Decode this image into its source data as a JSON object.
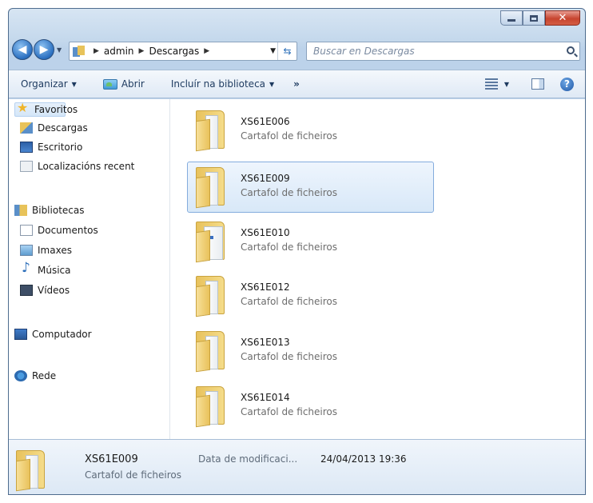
{
  "address": {
    "crumbs": [
      "admin",
      "Descargas"
    ],
    "search_placeholder": "Buscar en Descargas"
  },
  "toolbar": {
    "organize": "Organizar",
    "open": "Abrir",
    "include": "Incluír na biblioteca",
    "more": "»"
  },
  "nav": {
    "favorites": "Favoritos",
    "downloads": "Descargas",
    "desktop": "Escritorio",
    "recent": "Localizacións recent",
    "libraries": "Bibliotecas",
    "documents": "Documentos",
    "images": "Imaxes",
    "music": "Música",
    "videos": "Vídeos",
    "computer": "Computador",
    "network": "Rede"
  },
  "files": [
    {
      "name": "XS61E006",
      "type": "Cartafol de ficheiros"
    },
    {
      "name": "XS61E009",
      "type": "Cartafol de ficheiros"
    },
    {
      "name": "XS61E010",
      "type": "Cartafol de ficheiros"
    },
    {
      "name": "XS61E012",
      "type": "Cartafol de ficheiros"
    },
    {
      "name": "XS61E013",
      "type": "Cartafol de ficheiros"
    },
    {
      "name": "XS61E014",
      "type": "Cartafol de ficheiros"
    }
  ],
  "details": {
    "name": "XS61E009",
    "type": "Cartafol de ficheiros",
    "label": "Data de modificaci...",
    "value": "24/04/2013 19:36"
  }
}
